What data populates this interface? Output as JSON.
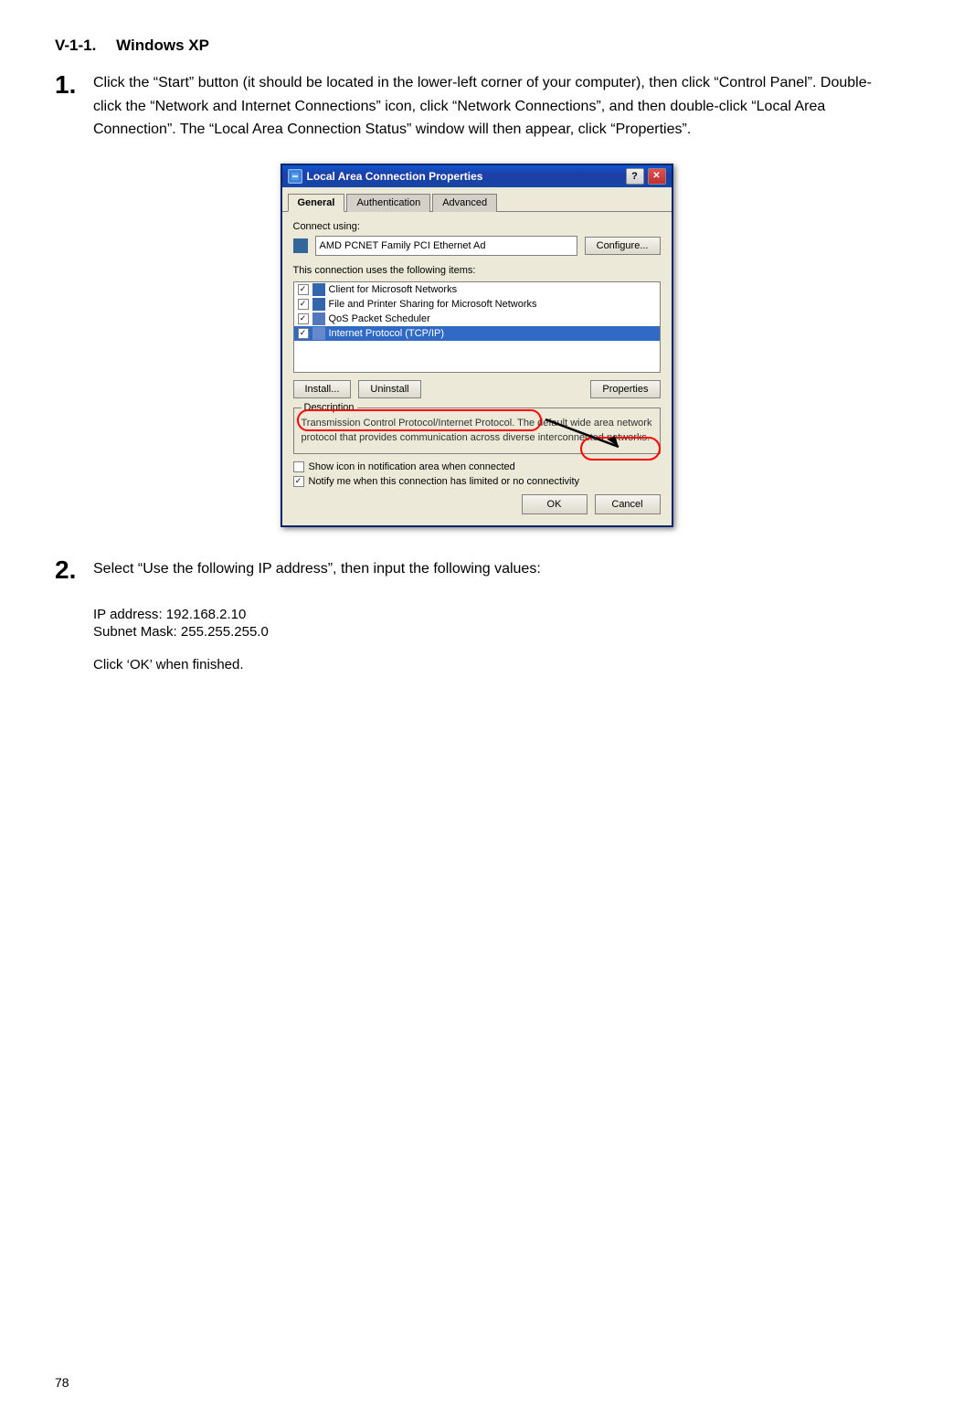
{
  "page": {
    "number": "78",
    "section_title": "V-1-1.  Windows XP",
    "step1": {
      "number": "1.",
      "text": "Click the “Start” button (it should be located in the lower-left corner of your computer), then click “Control Panel”. Double-click the “Network and Internet Connections” icon, click “Network Connections”, and then double-click “Local Area Connection”. The “Local Area Connection Status” window will then appear, click “Properties”."
    },
    "step2": {
      "number": "2.",
      "intro": "Select “Use the following IP address”, then input the following values:",
      "ip_label": "IP address",
      "ip_value": "192.168.2.10",
      "mask_label": "Subnet Mask",
      "mask_value": "255.255.255.0",
      "click_ok": "Click ‘OK’ when finished."
    },
    "dialog": {
      "title": "Local Area Connection Properties",
      "tabs": [
        "General",
        "Authentication",
        "Advanced"
      ],
      "active_tab": "General",
      "connect_using_label": "Connect using:",
      "adapter_name": "AMD PCNET Family PCI Ethernet Ad",
      "configure_btn": "Configure...",
      "items_label": "This connection uses the following items:",
      "list_items": [
        {
          "label": "Client for Microsoft Networks",
          "checked": true
        },
        {
          "label": "File and Printer Sharing for Microsoft Networks",
          "checked": true
        },
        {
          "label": "QoS Packet Scheduler",
          "checked": true
        },
        {
          "label": "Internet Protocol (TCP/IP)",
          "checked": true,
          "selected": true
        }
      ],
      "install_btn": "Install...",
      "uninstall_btn": "Uninstall",
      "properties_btn": "Properties",
      "description_title": "Description",
      "description_text": "Transmission Control Protocol/Internet Protocol. The default wide area network protocol that provides communication across diverse interconnected networks.",
      "show_icon_label": "Show icon in notification area when connected",
      "notify_label": "Notify me when this connection has limited or no connectivity",
      "ok_btn": "OK",
      "cancel_btn": "Cancel",
      "help_btn": "?",
      "close_btn": "✕"
    }
  }
}
